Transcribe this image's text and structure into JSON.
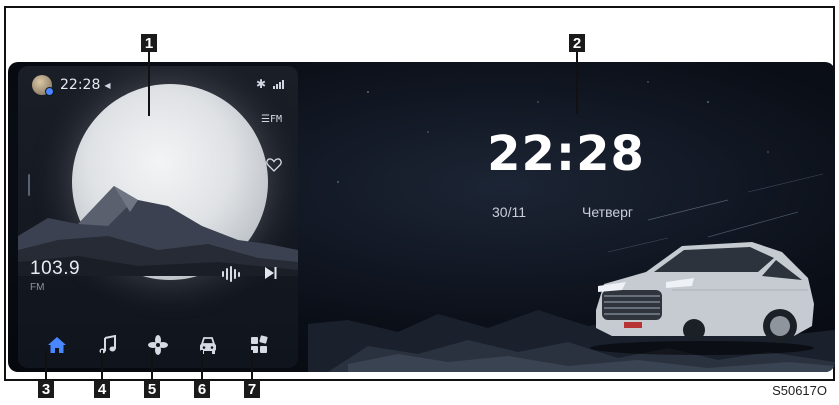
{
  "status_bar": {
    "time": "22:28",
    "icons": [
      "user-avatar",
      "navigation-arrow-icon",
      "bluetooth-icon",
      "signal-icon"
    ]
  },
  "media": {
    "frequency": "103.9",
    "band": "FM",
    "icons": [
      "fm-list-icon",
      "heart-icon",
      "audio-wave-icon",
      "next-track-icon"
    ]
  },
  "dock": {
    "items": [
      {
        "name": "home",
        "icon": "home-icon",
        "active": true
      },
      {
        "name": "music",
        "icon": "music-note-icon",
        "active": false
      },
      {
        "name": "climate",
        "icon": "fan-icon",
        "active": false
      },
      {
        "name": "vehicle",
        "icon": "car-icon",
        "active": false
      },
      {
        "name": "apps",
        "icon": "apps-grid-icon",
        "active": false
      }
    ]
  },
  "clock": {
    "time": "22:28",
    "date": "30/11",
    "weekday": "Четверг"
  },
  "callouts": [
    "1",
    "2",
    "3",
    "4",
    "5",
    "6",
    "7"
  ],
  "figure_code": "S50617O",
  "colors": {
    "accent": "#4a86ff",
    "icon": "#cfd6e2",
    "background": "#0b0f18"
  }
}
